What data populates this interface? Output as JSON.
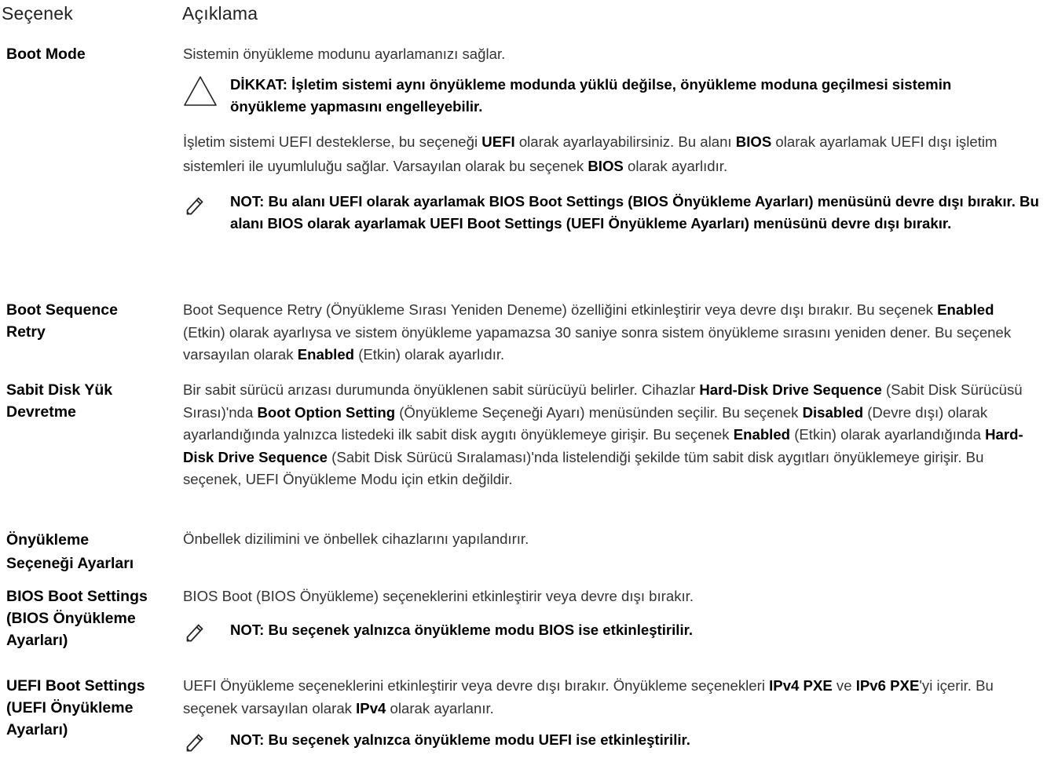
{
  "header": {
    "option": "Seçenek",
    "description": "Açıklama"
  },
  "rows": [
    {
      "label": "Boot Mode",
      "text": "Sistemin önyükleme modunu ayarlamanızı sağlar.",
      "caution": "DİKKAT: İşletim sistemi aynı önyükleme modunda yüklü değilse, önyükleme moduna geçilmesi sistemin önyükleme yapmasını engelleyebilir.",
      "para2": {
        "s1": "İşletim sistemi UEFI desteklerse, bu seçeneği ",
        "b1": "UEFI",
        "s2": " olarak ayarlayabilirsiniz. Bu alanı ",
        "b2": "BIOS",
        "s3": " olarak ayarlamak UEFI dışı işletim sistemleri ile uyumluluğu sağlar. Varsayılan olarak bu seçenek ",
        "b3": "BIOS",
        "s4": " olarak ayarlıdır."
      },
      "note": "NOT: Bu alanı UEFI olarak ayarlamak BIOS Boot Settings (BIOS Önyükleme Ayarları) menüsünü devre dışı bırakır. Bu alanı BIOS olarak ayarlamak UEFI Boot Settings (UEFI Önyükleme Ayarları) menüsünü devre dışı bırakır."
    },
    {
      "label": "Boot Sequence Retry",
      "s1": "Boot Sequence Retry (Önyükleme Sırası Yeniden Deneme) özelliğini etkinleştirir veya devre dışı bırakır. Bu seçenek ",
      "b1": "Enabled",
      "s2": " (Etkin) olarak ayarlıysa ve sistem önyükleme yapamazsa 30 saniye sonra sistem önyükleme sırasını yeniden dener. Bu seçenek varsayılan olarak ",
      "b2": "Enabled",
      "s3": " (Etkin) olarak ayarlıdır."
    },
    {
      "label": "Sabit Disk Yük Devretme",
      "s1": "Bir sabit sürücü arızası durumunda önyüklenen sabit sürücüyü belirler. Cihazlar ",
      "b1": "Hard-Disk Drive Sequence",
      "s2": " (Sabit Disk Sürücüsü Sırası)'nda ",
      "b2": "Boot Option Setting",
      "s3": " (Önyükleme Seçeneği Ayarı) menüsünden seçilir. Bu seçenek ",
      "b3": "Disabled",
      "s4": " (Devre dışı) olarak ayarlandığında yalnızca listedeki ilk sabit disk aygıtı önyüklemeye girişir. Bu seçenek ",
      "b4": "Enabled",
      "s5": " (Etkin) olarak ayarlandığında ",
      "b5": "Hard-Disk Drive Sequence",
      "s6": " (Sabit Disk Sürücü Sıralaması)'nda listelendiği şekilde tüm sabit disk aygıtları önyüklemeye girişir. Bu seçenek, UEFI Önyükleme Modu için etkin değildir."
    },
    {
      "label": "Önyükleme Seçeneği Ayarları",
      "text": "Önbellek dizilimini ve önbellek cihazlarını yapılandırır."
    },
    {
      "label": "BIOS Boot Settings (BIOS Önyükleme Ayarları)",
      "text": "BIOS Boot (BIOS Önyükleme) seçeneklerini etkinleştirir veya devre dışı bırakır.",
      "note": "NOT: Bu seçenek yalnızca önyükleme modu BIOS ise etkinleştirilir."
    },
    {
      "label": "UEFI Boot Settings (UEFI Önyükleme Ayarları)",
      "s1": "UEFI Önyükleme seçeneklerini etkinleştirir veya devre dışı bırakır. Önyükleme seçenekleri ",
      "b1": "IPv4 PXE",
      "s2": " ve ",
      "b2": "IPv6 PXE",
      "s3": "'yi içerir. Bu seçenek varsayılan olarak ",
      "b3": "IPv4",
      "s4": " olarak ayarlanır.",
      "note": "NOT: Bu seçenek yalnızca önyükleme modu UEFI ise etkinleştirilir."
    }
  ],
  "icons": {
    "caution": "warning-triangle-icon",
    "note": "pencil-note-icon"
  }
}
